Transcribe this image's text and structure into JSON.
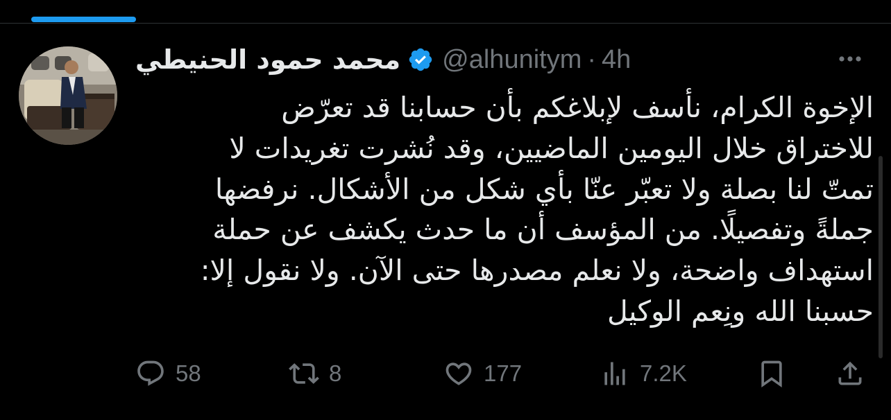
{
  "tweet": {
    "display_name": "محمد حمود الحنيطي",
    "handle": "@alhunitym",
    "separator": "·",
    "time": "4h",
    "verified_icon": "verified-badge-icon",
    "text": "الإخوة الكرام، نأسف لإبلاغكم بأن حسابنا قد تعرّض\nللاختراق خلال اليومين الماضيين، وقد نُشرت تغريدات لا\nتمتّ لنا بصلة ولا تعبّر عنّا بأي شكل من الأشكال. نرفضها\nجملةً وتفصيلًا. من المؤسف أن ما حدث يكشف عن حملة\nاستهداف واضحة، ولا نعلم مصدرها حتى الآن. ولا نقول إلا:\nحسبنا الله ونِعم الوكيل"
  },
  "actions": {
    "reply": {
      "count": "58",
      "icon": "reply-icon"
    },
    "retweet": {
      "count": "8",
      "icon": "retweet-icon"
    },
    "like": {
      "count": "177",
      "icon": "heart-icon"
    },
    "views": {
      "count": "7.2K",
      "icon": "views-icon"
    },
    "bookmark": {
      "icon": "bookmark-icon"
    },
    "share": {
      "icon": "share-icon"
    }
  },
  "colors": {
    "background": "#000000",
    "text": "#e7e9ea",
    "muted": "#71767b",
    "accent": "#1d9bf0"
  }
}
